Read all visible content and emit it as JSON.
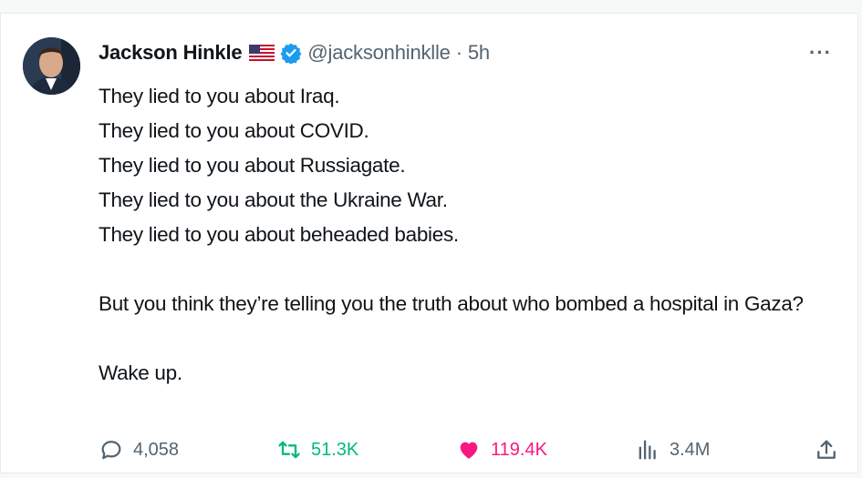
{
  "tweet": {
    "author": {
      "name": "Jackson Hinkle",
      "handle": "@jacksonhinklle",
      "separator": "·",
      "time": "5h"
    },
    "icons": {
      "flag": "us-flag-icon",
      "verified": "verified-badge-icon",
      "more": "more-options-icon"
    },
    "lines": [
      "They lied to you about Iraq.",
      "They lied to you about COVID.",
      "They lied to you about Russiagate.",
      "They lied to you about the Ukraine War.",
      "They lied to you about beheaded babies.",
      "But you think they’re telling you the truth about who bombed a hospital in Gaza?",
      "Wake up."
    ],
    "more_label": "···",
    "stats": {
      "replies": "4,058",
      "retweets": "51.3K",
      "likes": "119.4K",
      "views": "3.4M"
    },
    "colors": {
      "retweet": "#00ba7c",
      "like": "#f91880",
      "verified": "#1d9bf0",
      "muted": "#536471"
    }
  }
}
